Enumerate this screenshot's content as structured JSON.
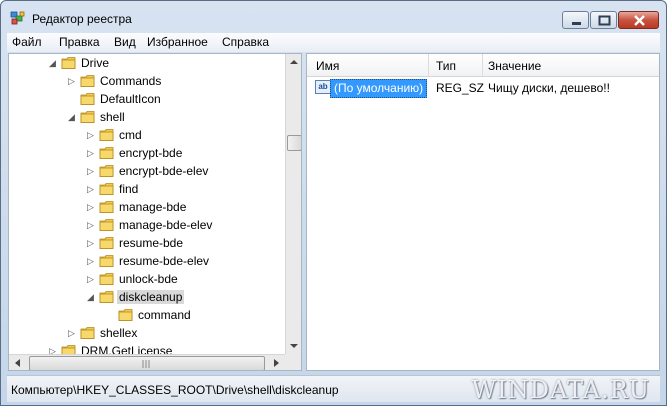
{
  "window": {
    "title": "Редактор реестра"
  },
  "menu": [
    "Файл",
    "Правка",
    "Вид",
    "Избранное",
    "Справка"
  ],
  "tree": {
    "items": [
      {
        "label": "Drive",
        "level": 0,
        "expanded": true
      },
      {
        "label": "Commands",
        "level": 1,
        "expanded": false,
        "has_children": true
      },
      {
        "label": "DefaultIcon",
        "level": 1,
        "has_children": false
      },
      {
        "label": "shell",
        "level": 1,
        "expanded": true
      },
      {
        "label": "cmd",
        "level": 2,
        "has_children": true
      },
      {
        "label": "encrypt-bde",
        "level": 2,
        "has_children": true
      },
      {
        "label": "encrypt-bde-elev",
        "level": 2,
        "has_children": true
      },
      {
        "label": "find",
        "level": 2,
        "has_children": true
      },
      {
        "label": "manage-bde",
        "level": 2,
        "has_children": true
      },
      {
        "label": "manage-bde-elev",
        "level": 2,
        "has_children": true
      },
      {
        "label": "resume-bde",
        "level": 2,
        "has_children": true
      },
      {
        "label": "resume-bde-elev",
        "level": 2,
        "has_children": true
      },
      {
        "label": "unlock-bde",
        "level": 2,
        "has_children": true
      },
      {
        "label": "diskcleanup",
        "level": 2,
        "expanded": true,
        "selected": true
      },
      {
        "label": "command",
        "level": 3,
        "has_children": false
      },
      {
        "label": "shellex",
        "level": 1,
        "has_children": true
      },
      {
        "label": "DRM.GetLicense",
        "level": 0,
        "has_children": true
      }
    ]
  },
  "list": {
    "columns": [
      "Имя",
      "Тип",
      "Значение"
    ],
    "rows": [
      {
        "icon": "string-value-icon",
        "icon_text": "ab",
        "name": "(По умолчанию)",
        "type": "REG_SZ",
        "value": "Чищу диски, дешево!!"
      }
    ]
  },
  "status": {
    "path": "Компьютер\\HKEY_CLASSES_ROOT\\Drive\\shell\\diskcleanup"
  },
  "watermark": "WINDATA.RU",
  "colors": {
    "selection": "#3399ff",
    "folder": "#f2c94c",
    "title_gradient_top": "#d7e3f1"
  }
}
